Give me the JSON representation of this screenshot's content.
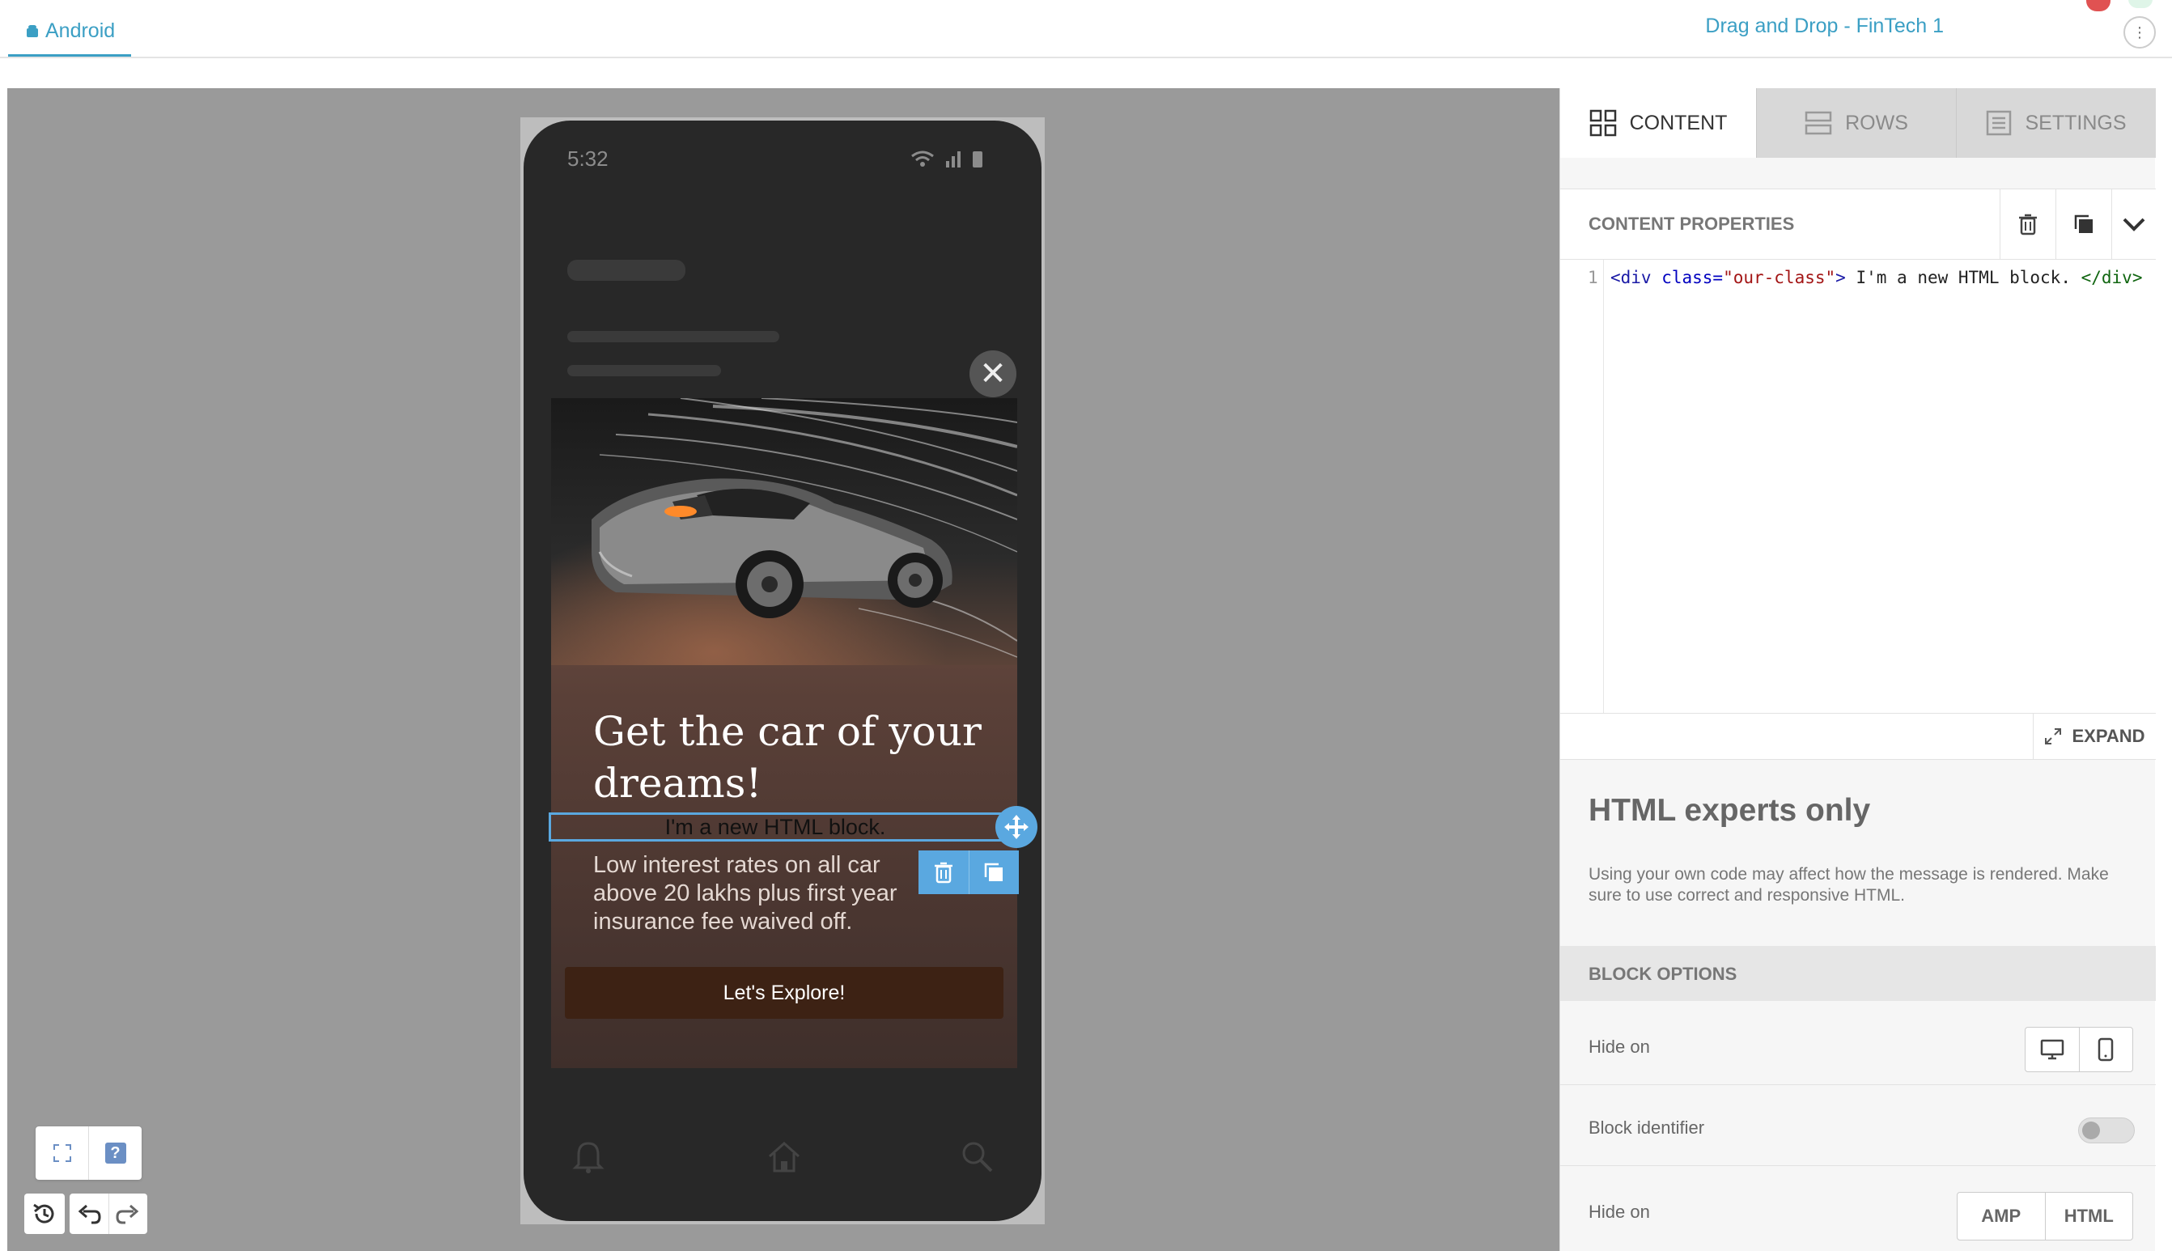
{
  "header": {
    "platform_tab": "Android",
    "campaign_name": "Drag and Drop - FinTech 1",
    "more_symbol": "⋮"
  },
  "phone": {
    "status_time": "5:32"
  },
  "popup": {
    "close_symbol": "✕",
    "title": "Get the car of your dreams!",
    "html_block_text": "I'm a new HTML block.",
    "body": "Low interest rates on all car above 20 lakhs plus first year insurance fee waived off.",
    "cta_label": "Let's Explore!"
  },
  "tools": {
    "help_symbol": "?"
  },
  "panel": {
    "tabs": [
      {
        "label": "CONTENT",
        "icon": "grid-icon",
        "active": true
      },
      {
        "label": "ROWS",
        "icon": "rows-icon",
        "active": false
      },
      {
        "label": "SETTINGS",
        "icon": "settings-icon",
        "active": false
      }
    ],
    "content_properties_title": "CONTENT PROPERTIES",
    "editor": {
      "line_number": "1",
      "code_open_tag": "<div ",
      "code_attr": "class=",
      "code_value": "\"our-class\"",
      "code_gt": ">",
      "code_text": " I'm a new HTML block. ",
      "code_close_tag": "</div>"
    },
    "expand_label": "EXPAND",
    "warning_title": "HTML experts only",
    "warning_text": "Using your own code may affect how the message is rendered. Make sure to use correct and responsive HTML.",
    "block_options_title": "BLOCK OPTIONS",
    "hide_on_label": "Hide on",
    "block_identifier_label": "Block identifier",
    "block_identifier_on": false,
    "hide_on_format_label": "Hide on",
    "formats": [
      "AMP",
      "HTML"
    ]
  },
  "colors": {
    "accent": "#3b9fc4",
    "selection": "#5aa8e0",
    "canvas": "#9a9a9a",
    "cta_bg": "#3d2214"
  }
}
